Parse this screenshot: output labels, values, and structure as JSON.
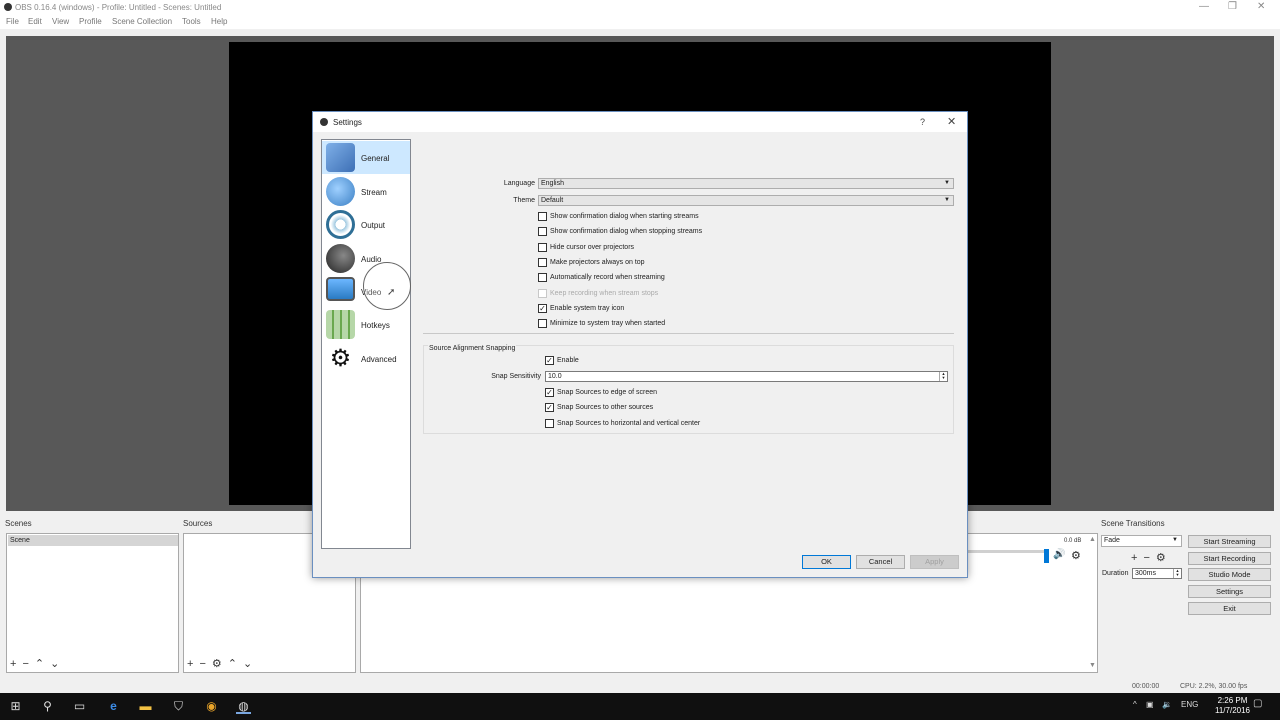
{
  "window": {
    "title": "OBS 0.16.4 (windows) - Profile: Untitled - Scenes: Untitled"
  },
  "menu": [
    "File",
    "Edit",
    "View",
    "Profile",
    "Scene Collection",
    "Tools",
    "Help"
  ],
  "docks": {
    "scenes_label": "Scenes",
    "sources_label": "Sources",
    "scene_transitions_label": "Scene Transitions",
    "scenes": [
      "Scene"
    ],
    "mixer_db": "0.0 dB",
    "transition": "Fade",
    "duration_label": "Duration",
    "duration_value": "300ms"
  },
  "controls": [
    "Start Streaming",
    "Start Recording",
    "Studio Mode",
    "Settings",
    "Exit"
  ],
  "status": {
    "time": "00:00:00",
    "cpu": "CPU: 2.2%, 30.00 fps"
  },
  "taskbar": {
    "lang": "ENG",
    "time": "2:26 PM",
    "date": "11/7/2016"
  },
  "settings": {
    "title": "Settings",
    "help": "?",
    "sidebar": [
      {
        "label": "General",
        "icon": "general-icon",
        "color": "#3d6fb5"
      },
      {
        "label": "Stream",
        "icon": "stream-globe-icon",
        "color": "#3a7fc4"
      },
      {
        "label": "Output",
        "icon": "output-broadcast-icon",
        "color": "#2f6f96"
      },
      {
        "label": "Audio",
        "icon": "audio-speaker-icon",
        "color": "#333333"
      },
      {
        "label": "Video",
        "icon": "video-monitor-icon",
        "color": "#2a7ac2"
      },
      {
        "label": "Hotkeys",
        "icon": "hotkeys-keyboard-icon",
        "color": "#6aa84f"
      },
      {
        "label": "Advanced",
        "icon": "advanced-gears-icon",
        "color": "#111111"
      }
    ],
    "general": {
      "language_label": "Language",
      "language_value": "English",
      "theme_label": "Theme",
      "theme_value": "Default",
      "checkboxes": [
        {
          "label": "Show confirmation dialog when starting streams",
          "checked": false,
          "disabled": false
        },
        {
          "label": "Show confirmation dialog when stopping streams",
          "checked": false,
          "disabled": false
        },
        {
          "label": "Hide cursor over projectors",
          "checked": false,
          "disabled": false
        },
        {
          "label": "Make projectors always on top",
          "checked": false,
          "disabled": false
        },
        {
          "label": "Automatically record when streaming",
          "checked": false,
          "disabled": false
        },
        {
          "label": "Keep recording when stream stops",
          "checked": false,
          "disabled": true
        },
        {
          "label": "Enable system tray icon",
          "checked": true,
          "disabled": false
        },
        {
          "label": "Minimize to system tray when started",
          "checked": false,
          "disabled": false
        }
      ],
      "snapping": {
        "title": "Source Alignment Snapping",
        "enable_label": "Enable",
        "enable_checked": true,
        "sensitivity_label": "Snap Sensitivity",
        "sensitivity_value": "10.0",
        "options": [
          {
            "label": "Snap Sources to edge of screen",
            "checked": true
          },
          {
            "label": "Snap Sources to other sources",
            "checked": true
          },
          {
            "label": "Snap Sources to horizontal and vertical center",
            "checked": false
          }
        ]
      }
    },
    "buttons": {
      "ok": "OK",
      "cancel": "Cancel",
      "apply": "Apply"
    }
  }
}
